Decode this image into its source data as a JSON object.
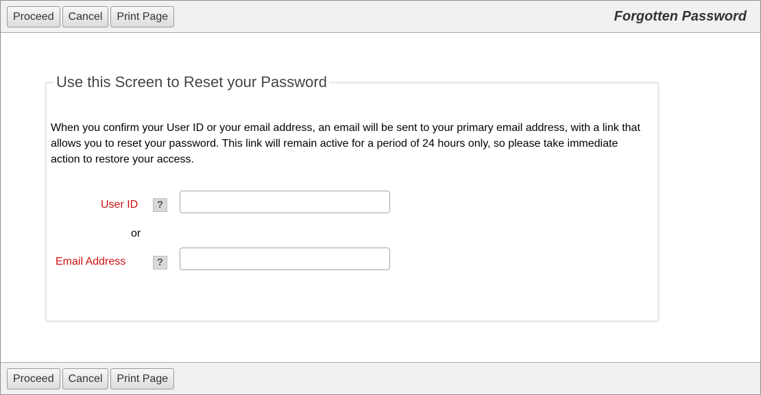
{
  "toolbar": {
    "buttons": [
      "Proceed",
      "Cancel",
      "Print Page"
    ]
  },
  "header": {
    "title": "Forgotten Password"
  },
  "panel": {
    "legend": "Use this Screen to Reset your Password",
    "intro": "When you confirm your User ID or your email address, an email will be sent to your primary email address, with a link that allows you to reset your password. This link will remain active for a period of 24 hours only, so please take immediate action to restore your access."
  },
  "form": {
    "user_id_label": "User ID",
    "user_id_value": "",
    "or_text": "or",
    "email_label": "Email Address",
    "email_value": "",
    "help_glyph": "?",
    "help_icon": "question-mark-icon"
  },
  "colors": {
    "label_required": "#cc1111",
    "toolbar_bg": "#f1f1f1"
  }
}
